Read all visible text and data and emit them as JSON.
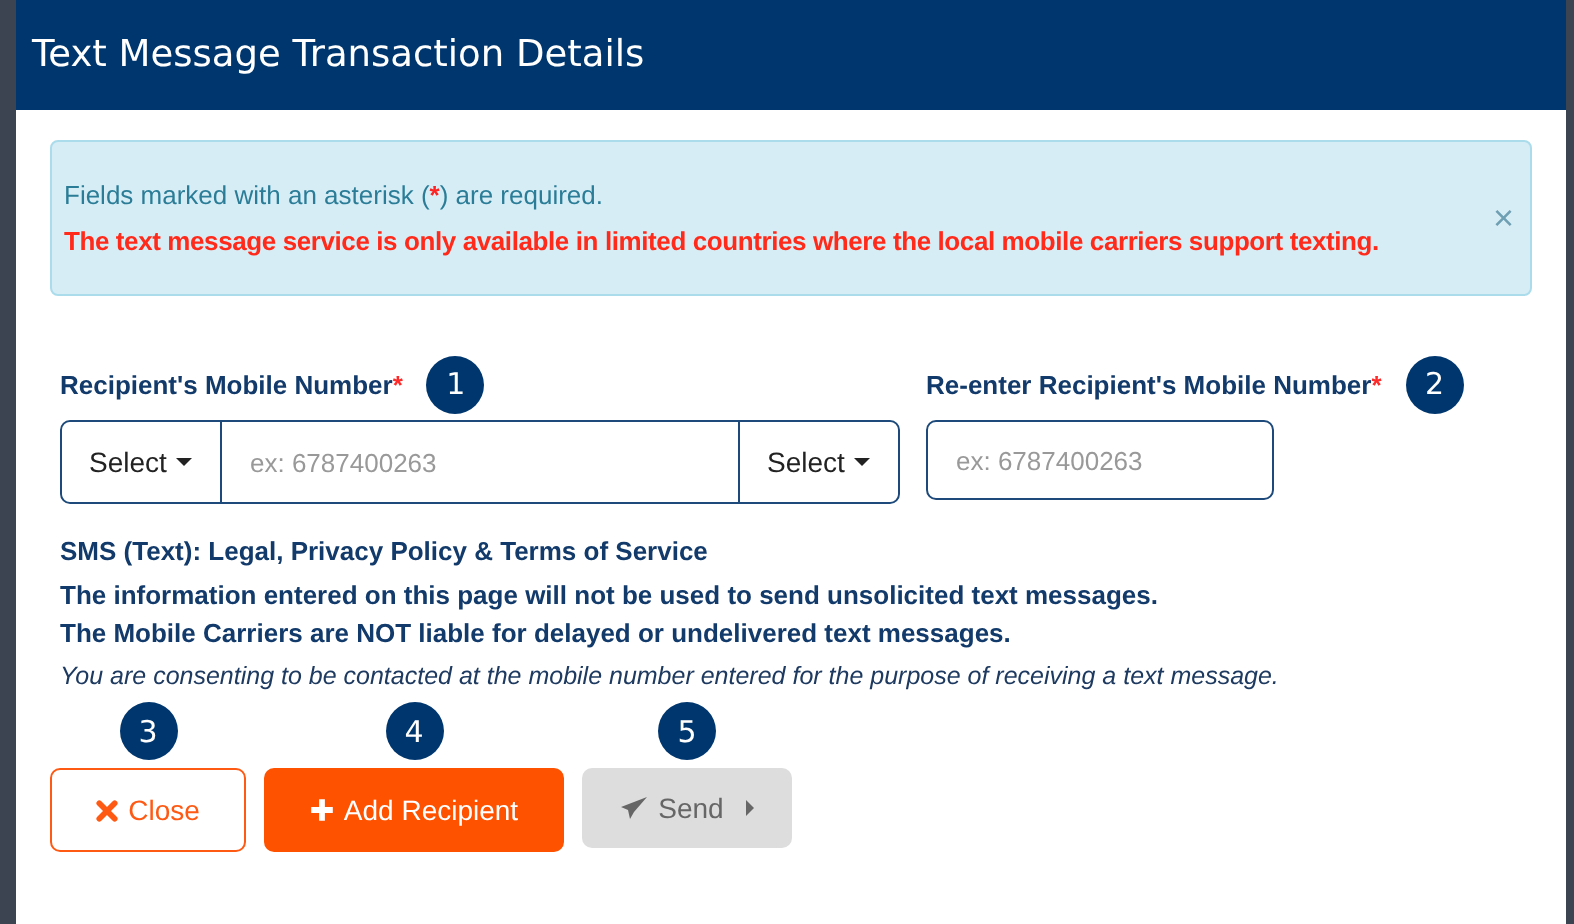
{
  "dialog": {
    "title": "Text Message Transaction Details"
  },
  "alert": {
    "info": {
      "before": "Fields marked with an asterisk (",
      "mark": "*",
      "after": ") are required."
    },
    "warning": "The text message service is only available in limited countries where the local mobile carriers support texting.",
    "close": "×"
  },
  "fields": [
    {
      "kind": "group",
      "label": "Recipient's Mobile Number",
      "required": true,
      "callout": "1",
      "prefix": "Select",
      "placeholder": "ex: 6787400263",
      "suffix": "Select"
    },
    {
      "kind": "single",
      "label": "Re-enter Recipient's Mobile Number",
      "required": true,
      "callout": "2",
      "placeholder": "ex: 6787400263"
    }
  ],
  "required_mark": "*",
  "legal": {
    "title": "SMS (Text): Legal, Privacy Policy & Terms of Service",
    "lines": [
      "The information entered on this page will not be used to send unsolicited text messages.",
      "The Mobile Carriers are NOT liable for delayed or undelivered text messages."
    ],
    "consent": "You are consenting to be contacted at the mobile number entered for the purpose of receiving a text message."
  },
  "buttons": [
    {
      "kind": "close",
      "label": "Close",
      "callout": "3",
      "disabled": false
    },
    {
      "kind": "add",
      "label": "Add Recipient",
      "callout": "4",
      "disabled": false
    },
    {
      "kind": "send",
      "label": "Send",
      "callout": "5",
      "disabled": true
    }
  ]
}
